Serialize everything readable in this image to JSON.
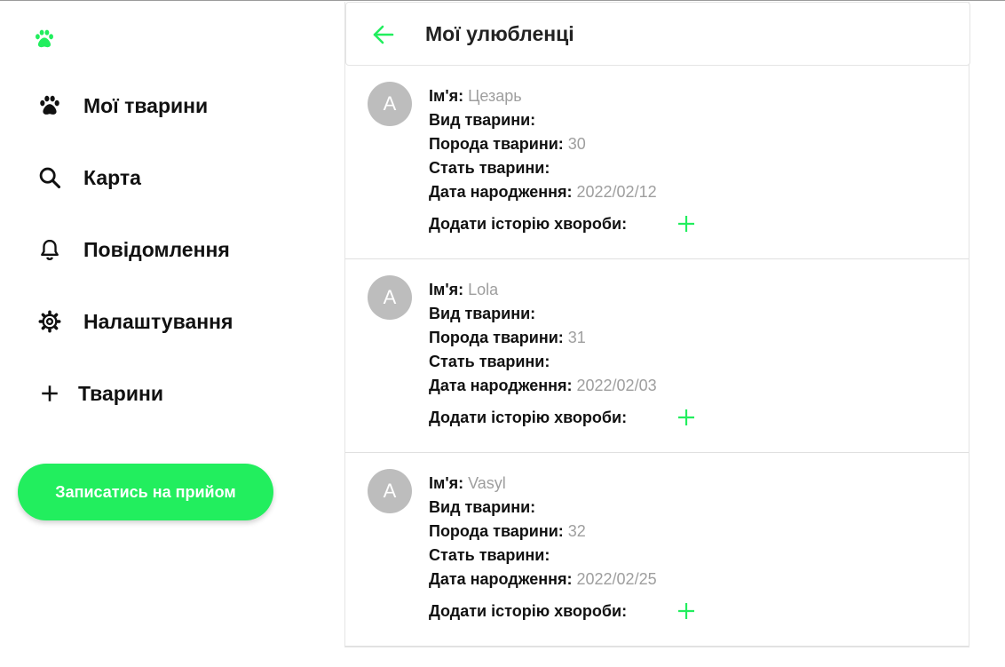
{
  "colors": {
    "accent": "#22ee5e",
    "muted": "#9e9e9e",
    "avatar": "#bdbdbd"
  },
  "sidebar": {
    "logo_icon": "paw-icon",
    "items": [
      {
        "label": "Мої тварини",
        "icon": "paw-icon"
      },
      {
        "label": "Карта",
        "icon": "search-icon"
      },
      {
        "label": "Повідомлення",
        "icon": "bell-icon"
      },
      {
        "label": "Налаштування",
        "icon": "gear-icon"
      },
      {
        "label": "Тварини",
        "icon": "plus-icon"
      }
    ],
    "cta_label": "Записатись на прийом"
  },
  "header": {
    "title": "Мої улюбленці",
    "back_icon": "arrow-left-icon"
  },
  "field_labels": {
    "name": "Ім'я:",
    "species": "Вид тварини:",
    "breed": "Порода тварини:",
    "sex": "Стать тварини:",
    "birth": "Дата народження:",
    "add_history": "Додати історію хвороби:"
  },
  "pets": [
    {
      "avatar": "A",
      "name": "Цезарь",
      "species": "",
      "breed": "30",
      "sex": "",
      "birth": "2022/02/12"
    },
    {
      "avatar": "A",
      "name": "Lola",
      "species": "",
      "breed": "31",
      "sex": "",
      "birth": "2022/02/03"
    },
    {
      "avatar": "A",
      "name": "Vasyl",
      "species": "",
      "breed": "32",
      "sex": "",
      "birth": "2022/02/25"
    }
  ]
}
